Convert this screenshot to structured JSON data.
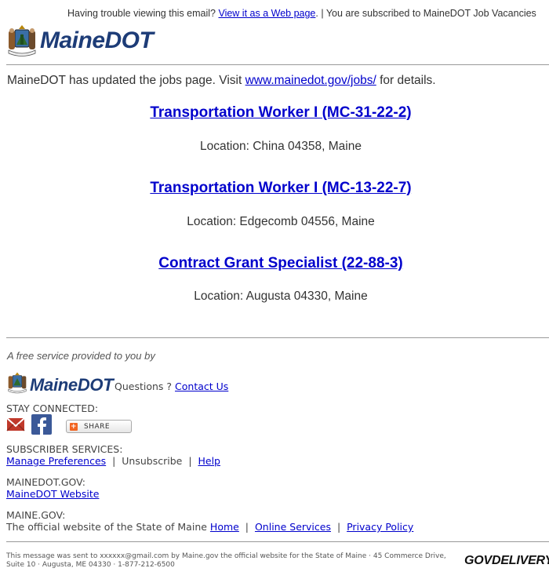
{
  "topbar": {
    "prefix": "Having trouble viewing this email?",
    "link": "View it as a Web page",
    "suffix": ". | You are subscribed to MaineDOT Job Vacancies"
  },
  "header": {
    "brand": "MaineDOT"
  },
  "intro": {
    "text_before": "MaineDOT has updated the jobs page. Visit",
    "link": "www.mainedot.gov/jobs/",
    "text_after": "for details."
  },
  "jobs": [
    {
      "title": "Transportation Worker I (MC-31-22-2)",
      "location": "Location: China 04358, Maine"
    },
    {
      "title": "Transportation Worker I (MC-13-22-7)",
      "location": "Location: Edgecomb 04556, Maine"
    },
    {
      "title": "Contract Grant Specialist (22-88-3)",
      "location": "Location: Augusta 04330, Maine"
    }
  ],
  "footer": {
    "free_service": "A free service provided to you by",
    "brand": "MaineDOT",
    "questions": "Questions ?",
    "contact_link": "Contact Us",
    "stay_connected": "STAY CONNECTED:",
    "share_label": "SHARE",
    "subscriber_services": "SUBSCRIBER SERVICES:",
    "manage_preferences": "Manage Preferences",
    "sep": "|",
    "unsubscribe": "Unsubscribe",
    "help": "Help",
    "mainedot_gov": "MAINEDOT.GOV:",
    "mainedot_website": "MaineDOT Website",
    "maine_gov": "MAINE.GOV:",
    "official_text": "The official website of the State of Maine",
    "home": "Home",
    "online_services": "Online Services",
    "privacy_policy": "Privacy Policy",
    "fineprint": "This message was sent to xxxxxx@gmail.com by Maine.gov the official website for the State of Maine · 45 Commerce Drive, Suite 10 · Augusta, ME 04330 · 1-877-212-6500",
    "govdelivery": "GOVDELIVERY"
  },
  "colors": {
    "link": "#0000cc",
    "brand": "#1d3c77",
    "text": "#333333"
  }
}
